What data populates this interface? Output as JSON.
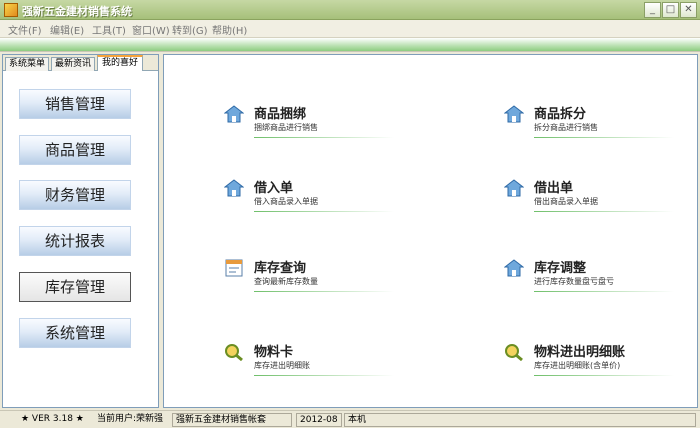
{
  "window": {
    "title": "强新五金建材销售系统"
  },
  "menu": [
    {
      "label": "文件(F)"
    },
    {
      "label": "编辑(E)"
    },
    {
      "label": "工具(T)"
    },
    {
      "label": "窗口(W)"
    },
    {
      "label": "转到(G)"
    },
    {
      "label": "帮助(H)"
    }
  ],
  "left": {
    "tabs": [
      "系统菜单",
      "最新资讯",
      "我的喜好"
    ],
    "active_tab": 2,
    "nav": [
      "销售管理",
      "商品管理",
      "财务管理",
      "统计报表",
      "库存管理",
      "系统管理"
    ],
    "selected_nav": 4
  },
  "functions": [
    {
      "title": "商品捆绑",
      "desc": "捆绑商品进行销售",
      "icon": "house-icon"
    },
    {
      "title": "商品拆分",
      "desc": "拆分商品进行销售",
      "icon": "house-icon"
    },
    {
      "title": "借入单",
      "desc": "借入商品录入单据",
      "icon": "house-icon"
    },
    {
      "title": "借出单",
      "desc": "借出商品录入单据",
      "icon": "house-icon"
    },
    {
      "title": "库存查询",
      "desc": "查询最新库存数量",
      "icon": "report-icon"
    },
    {
      "title": "库存调整",
      "desc": "进行库存数量盘亏盘亏",
      "icon": "house-icon"
    },
    {
      "title": "物料卡",
      "desc": "库存进出明细账",
      "icon": "magnifier-icon"
    },
    {
      "title": "物料进出明细账",
      "desc": "库存进出明细账(含单价)",
      "icon": "magnifier-icon"
    }
  ],
  "status": {
    "version": "★ VER 3.18 ★",
    "user": "当前用户:荣新强",
    "account": "强新五金建材销售帐套",
    "date": "2012-08",
    "machine": "本机"
  },
  "colors": {
    "title_bar": "#a6c07a",
    "toolbar_accent": "#8dcc80",
    "func_line": "#6fbf6a",
    "active_tab": "#f7a33a"
  }
}
